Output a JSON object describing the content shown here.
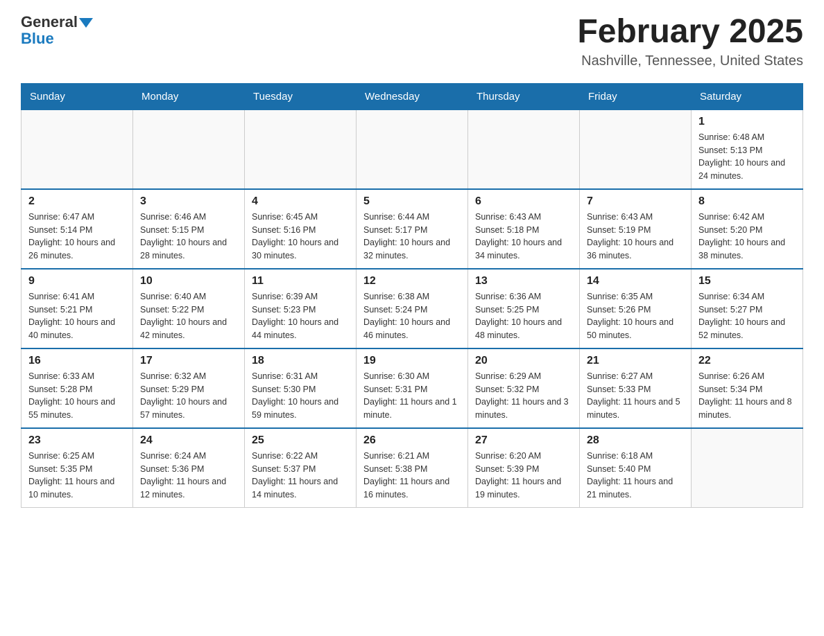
{
  "header": {
    "logo_general": "General",
    "logo_blue": "Blue",
    "month_title": "February 2025",
    "location": "Nashville, Tennessee, United States"
  },
  "weekdays": [
    "Sunday",
    "Monday",
    "Tuesday",
    "Wednesday",
    "Thursday",
    "Friday",
    "Saturday"
  ],
  "weeks": [
    [
      {
        "day": "",
        "detail": ""
      },
      {
        "day": "",
        "detail": ""
      },
      {
        "day": "",
        "detail": ""
      },
      {
        "day": "",
        "detail": ""
      },
      {
        "day": "",
        "detail": ""
      },
      {
        "day": "",
        "detail": ""
      },
      {
        "day": "1",
        "detail": "Sunrise: 6:48 AM\nSunset: 5:13 PM\nDaylight: 10 hours and 24 minutes."
      }
    ],
    [
      {
        "day": "2",
        "detail": "Sunrise: 6:47 AM\nSunset: 5:14 PM\nDaylight: 10 hours and 26 minutes."
      },
      {
        "day": "3",
        "detail": "Sunrise: 6:46 AM\nSunset: 5:15 PM\nDaylight: 10 hours and 28 minutes."
      },
      {
        "day": "4",
        "detail": "Sunrise: 6:45 AM\nSunset: 5:16 PM\nDaylight: 10 hours and 30 minutes."
      },
      {
        "day": "5",
        "detail": "Sunrise: 6:44 AM\nSunset: 5:17 PM\nDaylight: 10 hours and 32 minutes."
      },
      {
        "day": "6",
        "detail": "Sunrise: 6:43 AM\nSunset: 5:18 PM\nDaylight: 10 hours and 34 minutes."
      },
      {
        "day": "7",
        "detail": "Sunrise: 6:43 AM\nSunset: 5:19 PM\nDaylight: 10 hours and 36 minutes."
      },
      {
        "day": "8",
        "detail": "Sunrise: 6:42 AM\nSunset: 5:20 PM\nDaylight: 10 hours and 38 minutes."
      }
    ],
    [
      {
        "day": "9",
        "detail": "Sunrise: 6:41 AM\nSunset: 5:21 PM\nDaylight: 10 hours and 40 minutes."
      },
      {
        "day": "10",
        "detail": "Sunrise: 6:40 AM\nSunset: 5:22 PM\nDaylight: 10 hours and 42 minutes."
      },
      {
        "day": "11",
        "detail": "Sunrise: 6:39 AM\nSunset: 5:23 PM\nDaylight: 10 hours and 44 minutes."
      },
      {
        "day": "12",
        "detail": "Sunrise: 6:38 AM\nSunset: 5:24 PM\nDaylight: 10 hours and 46 minutes."
      },
      {
        "day": "13",
        "detail": "Sunrise: 6:36 AM\nSunset: 5:25 PM\nDaylight: 10 hours and 48 minutes."
      },
      {
        "day": "14",
        "detail": "Sunrise: 6:35 AM\nSunset: 5:26 PM\nDaylight: 10 hours and 50 minutes."
      },
      {
        "day": "15",
        "detail": "Sunrise: 6:34 AM\nSunset: 5:27 PM\nDaylight: 10 hours and 52 minutes."
      }
    ],
    [
      {
        "day": "16",
        "detail": "Sunrise: 6:33 AM\nSunset: 5:28 PM\nDaylight: 10 hours and 55 minutes."
      },
      {
        "day": "17",
        "detail": "Sunrise: 6:32 AM\nSunset: 5:29 PM\nDaylight: 10 hours and 57 minutes."
      },
      {
        "day": "18",
        "detail": "Sunrise: 6:31 AM\nSunset: 5:30 PM\nDaylight: 10 hours and 59 minutes."
      },
      {
        "day": "19",
        "detail": "Sunrise: 6:30 AM\nSunset: 5:31 PM\nDaylight: 11 hours and 1 minute."
      },
      {
        "day": "20",
        "detail": "Sunrise: 6:29 AM\nSunset: 5:32 PM\nDaylight: 11 hours and 3 minutes."
      },
      {
        "day": "21",
        "detail": "Sunrise: 6:27 AM\nSunset: 5:33 PM\nDaylight: 11 hours and 5 minutes."
      },
      {
        "day": "22",
        "detail": "Sunrise: 6:26 AM\nSunset: 5:34 PM\nDaylight: 11 hours and 8 minutes."
      }
    ],
    [
      {
        "day": "23",
        "detail": "Sunrise: 6:25 AM\nSunset: 5:35 PM\nDaylight: 11 hours and 10 minutes."
      },
      {
        "day": "24",
        "detail": "Sunrise: 6:24 AM\nSunset: 5:36 PM\nDaylight: 11 hours and 12 minutes."
      },
      {
        "day": "25",
        "detail": "Sunrise: 6:22 AM\nSunset: 5:37 PM\nDaylight: 11 hours and 14 minutes."
      },
      {
        "day": "26",
        "detail": "Sunrise: 6:21 AM\nSunset: 5:38 PM\nDaylight: 11 hours and 16 minutes."
      },
      {
        "day": "27",
        "detail": "Sunrise: 6:20 AM\nSunset: 5:39 PM\nDaylight: 11 hours and 19 minutes."
      },
      {
        "day": "28",
        "detail": "Sunrise: 6:18 AM\nSunset: 5:40 PM\nDaylight: 11 hours and 21 minutes."
      },
      {
        "day": "",
        "detail": ""
      }
    ]
  ]
}
